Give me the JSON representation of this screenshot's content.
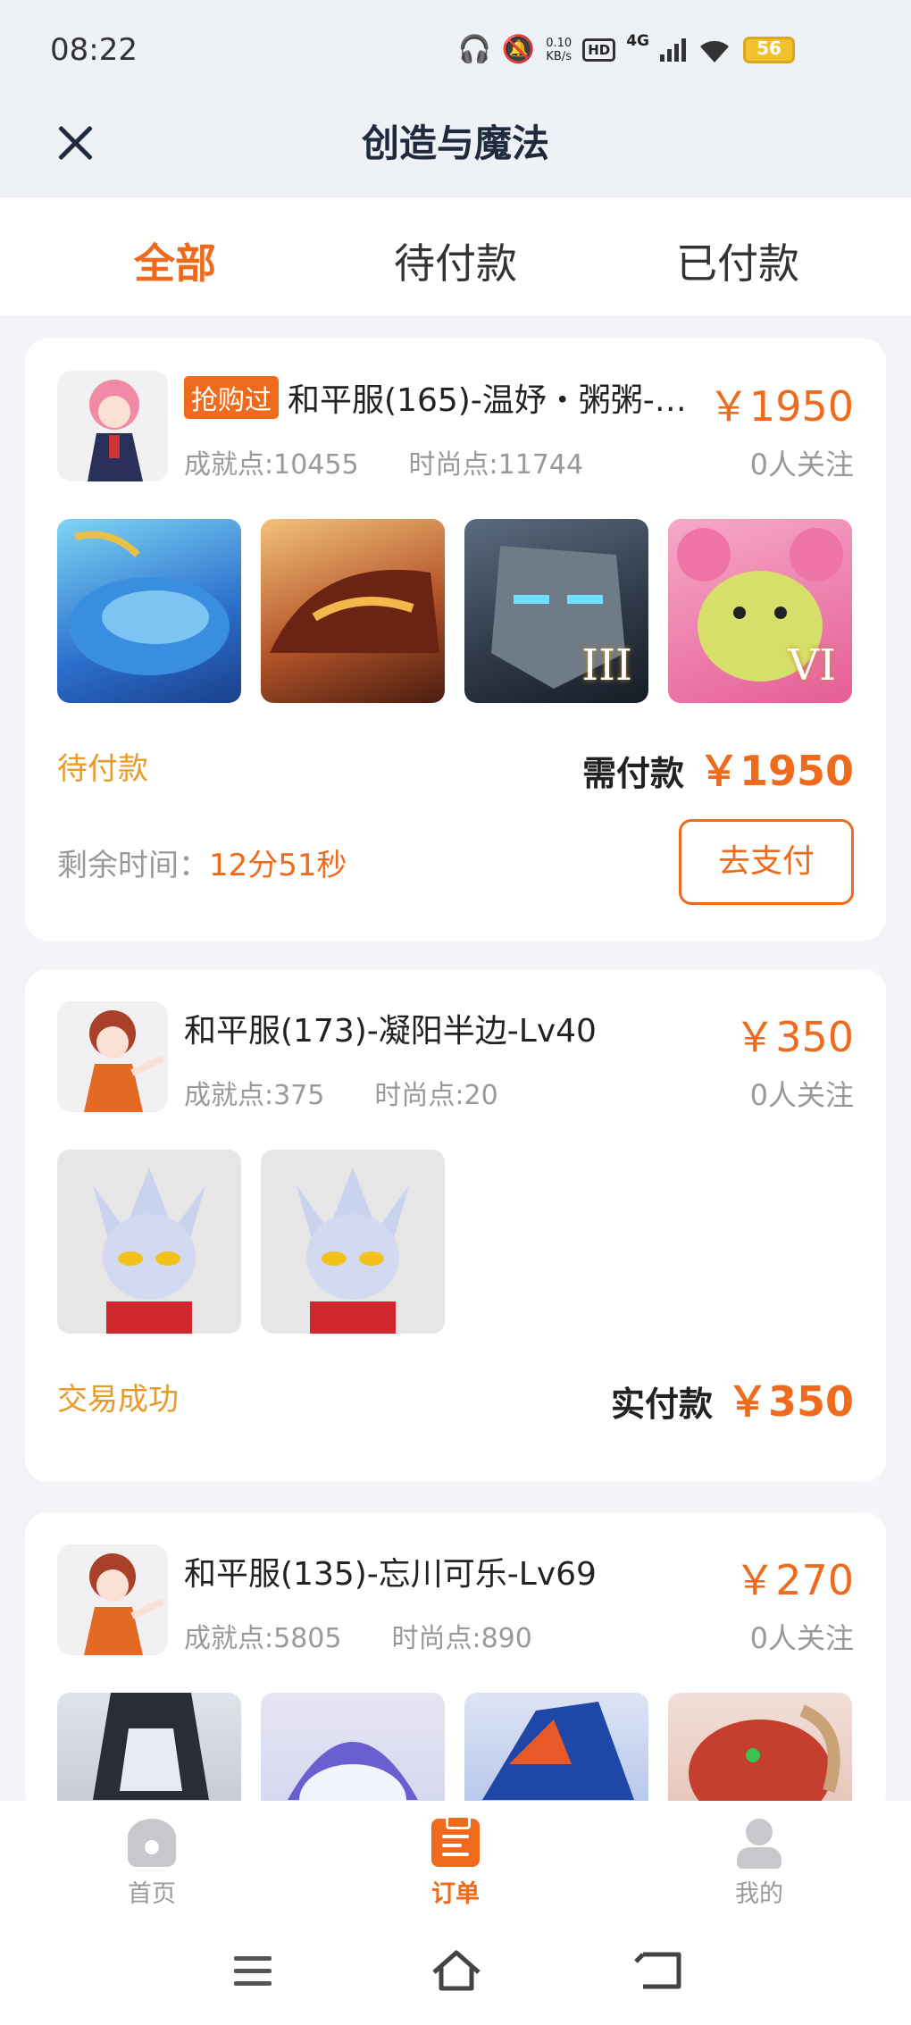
{
  "status_bar": {
    "time": "08:22",
    "net_speed_value": "0.10",
    "net_speed_unit": "KB/s",
    "hd": "HD",
    "network": "4G",
    "battery": "56"
  },
  "header": {
    "title": "创造与魔法"
  },
  "tabs": [
    {
      "label": "全部",
      "active": true
    },
    {
      "label": "待付款",
      "active": false
    },
    {
      "label": "已付款",
      "active": false
    }
  ],
  "orders": [
    {
      "tag": "抢购过",
      "title": "和平服(165)-温妤・粥粥-…",
      "achievement": "成就点:10455",
      "fashion": "时尚点:11744",
      "price": "￥1950",
      "followers": "0人关注",
      "thumb_badges": [
        "",
        "",
        "III",
        "VI"
      ],
      "status": "待付款",
      "pay_label": "需付款",
      "pay_amount": "￥1950",
      "remaining_label": "剩余时间：",
      "remaining_value": "12分51秒",
      "action": "去支付"
    },
    {
      "title": "和平服(173)-凝阳半边-Lv40",
      "achievement": "成就点:375",
      "fashion": "时尚点:20",
      "price": "￥350",
      "followers": "0人关注",
      "status": "交易成功",
      "pay_label": "实付款",
      "pay_amount": "￥350"
    },
    {
      "title": "和平服(135)-忘川可乐-Lv69",
      "achievement": "成就点:5805",
      "fashion": "时尚点:890",
      "price": "￥270",
      "followers": "0人关注"
    }
  ],
  "bottom_nav": [
    {
      "label": "首页",
      "icon": "home-icon",
      "active": false
    },
    {
      "label": "订单",
      "icon": "order-icon",
      "active": true
    },
    {
      "label": "我的",
      "icon": "profile-icon",
      "active": false
    }
  ],
  "colors": {
    "accent": "#ee6a1c",
    "status_pending": "#e89a2a"
  }
}
